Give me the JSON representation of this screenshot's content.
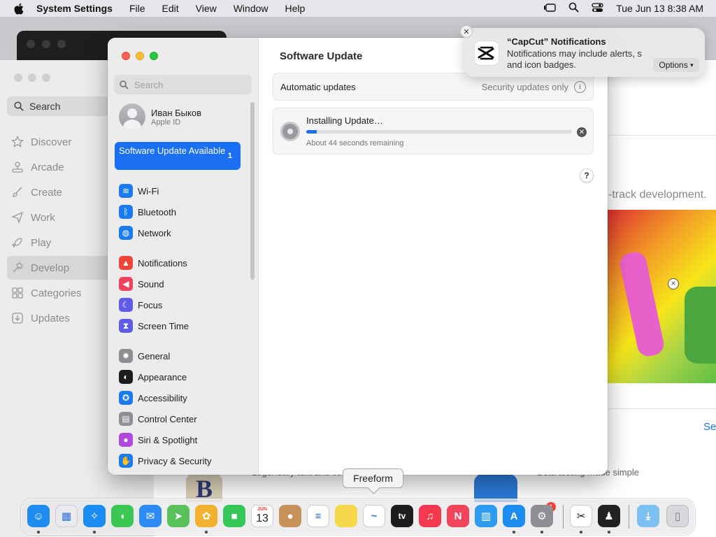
{
  "menubar": {
    "app_name": "System Settings",
    "items": [
      "File",
      "Edit",
      "View",
      "Window",
      "Help"
    ],
    "clock": "Tue Jun 13  8:38 AM"
  },
  "appstore": {
    "search_label": "Search",
    "nav": [
      "Discover",
      "Arcade",
      "Create",
      "Work",
      "Play",
      "Develop",
      "Categories",
      "Updates"
    ],
    "selected": "Develop",
    "tagline": "-track development.",
    "see_link": "Se",
    "bottom_left_text": "Legendary text and co",
    "bottom_right_text": "Beta testing made simple"
  },
  "settings": {
    "search_placeholder": "Search",
    "profile": {
      "name": "Иван Быков",
      "subtitle": "Apple ID"
    },
    "update_banner": {
      "label": "Software Update Available",
      "badge": "1"
    },
    "sidebar_groups": [
      [
        {
          "label": "Wi-Fi",
          "icon": "wifi-icon",
          "color": "#1b7cf2"
        },
        {
          "label": "Bluetooth",
          "icon": "bluetooth-icon",
          "color": "#1b7cf2"
        },
        {
          "label": "Network",
          "icon": "globe-icon",
          "color": "#1b7cf2"
        }
      ],
      [
        {
          "label": "Notifications",
          "icon": "bell-icon",
          "color": "#f0443a"
        },
        {
          "label": "Sound",
          "icon": "speaker-icon",
          "color": "#f0445e"
        },
        {
          "label": "Focus",
          "icon": "moon-icon",
          "color": "#5e5ce6"
        },
        {
          "label": "Screen Time",
          "icon": "hourglass-icon",
          "color": "#5e5ce6"
        }
      ],
      [
        {
          "label": "General",
          "icon": "gear-icon",
          "color": "#8e8e93"
        },
        {
          "label": "Appearance",
          "icon": "appearance-icon",
          "color": "#1d1d1f"
        },
        {
          "label": "Accessibility",
          "icon": "accessibility-icon",
          "color": "#1b7cf2"
        },
        {
          "label": "Control Center",
          "icon": "control-center-icon",
          "color": "#8e8e93"
        },
        {
          "label": "Siri & Spotlight",
          "icon": "siri-icon",
          "color": "#b04adf"
        },
        {
          "label": "Privacy & Security",
          "icon": "hand-icon",
          "color": "#1b7cf2"
        }
      ]
    ],
    "main": {
      "title": "Software Update",
      "auto_updates_label": "Automatic updates",
      "auto_updates_value": "Security updates only",
      "install_title": "Installing Update…",
      "install_progress": 0.04,
      "install_remaining": "About 44 seconds remaining",
      "help_label": "?"
    }
  },
  "notification": {
    "title": "“CapCut” Notifications",
    "body": "Notifications may include alerts, s  and icon badges.",
    "options_label": "Options"
  },
  "tooltip": "Freeform",
  "dock": {
    "apps": [
      {
        "name": "Finder",
        "icon": "finder-icon",
        "color": "#1e8cf0",
        "running": true
      },
      {
        "name": "Launchpad",
        "icon": "launchpad-icon",
        "color": "#e9e9ee",
        "running": false
      },
      {
        "name": "Safari",
        "icon": "safari-icon",
        "color": "#1b8cf2",
        "running": true
      },
      {
        "name": "Messages",
        "icon": "messages-icon",
        "color": "#3cc753",
        "running": false
      },
      {
        "name": "Mail",
        "icon": "mail-icon",
        "color": "#2d8cf4",
        "running": false
      },
      {
        "name": "Maps",
        "icon": "maps-icon",
        "color": "#58c15a",
        "running": false
      },
      {
        "name": "Photos",
        "icon": "photos-icon",
        "color": "#f2b230",
        "running": true
      },
      {
        "name": "FaceTime",
        "icon": "facetime-icon",
        "color": "#35c758",
        "running": false
      },
      {
        "name": "Calendar",
        "icon": "calendar-icon",
        "color": "#ffffff",
        "running": false
      },
      {
        "name": "Contacts",
        "icon": "contacts-icon",
        "color": "#c7925a",
        "running": false
      },
      {
        "name": "Reminders",
        "icon": "reminders-icon",
        "color": "#ffffff",
        "running": false
      },
      {
        "name": "Notes",
        "icon": "notes-icon",
        "color": "#f7d84a",
        "running": false
      },
      {
        "name": "Freeform",
        "icon": "freeform-icon",
        "color": "#ffffff",
        "running": false
      },
      {
        "name": "TV",
        "icon": "tv-icon",
        "color": "#1d1d1f",
        "running": false
      },
      {
        "name": "Music",
        "icon": "music-icon",
        "color": "#f4384e",
        "running": false
      },
      {
        "name": "News",
        "icon": "news-icon",
        "color": "#f2445b",
        "running": false
      },
      {
        "name": "Keynote",
        "icon": "keynote-icon",
        "color": "#2d9cf0",
        "running": false
      },
      {
        "name": "App Store",
        "icon": "app-store-icon",
        "color": "#1b8cf2",
        "running": true
      },
      {
        "name": "System Settings",
        "icon": "settings-icon",
        "color": "#8e8e93",
        "running": true
      }
    ],
    "settings_badge": "1",
    "calendar_month": "JUN",
    "calendar_day": "13",
    "tv_label": "tv"
  }
}
